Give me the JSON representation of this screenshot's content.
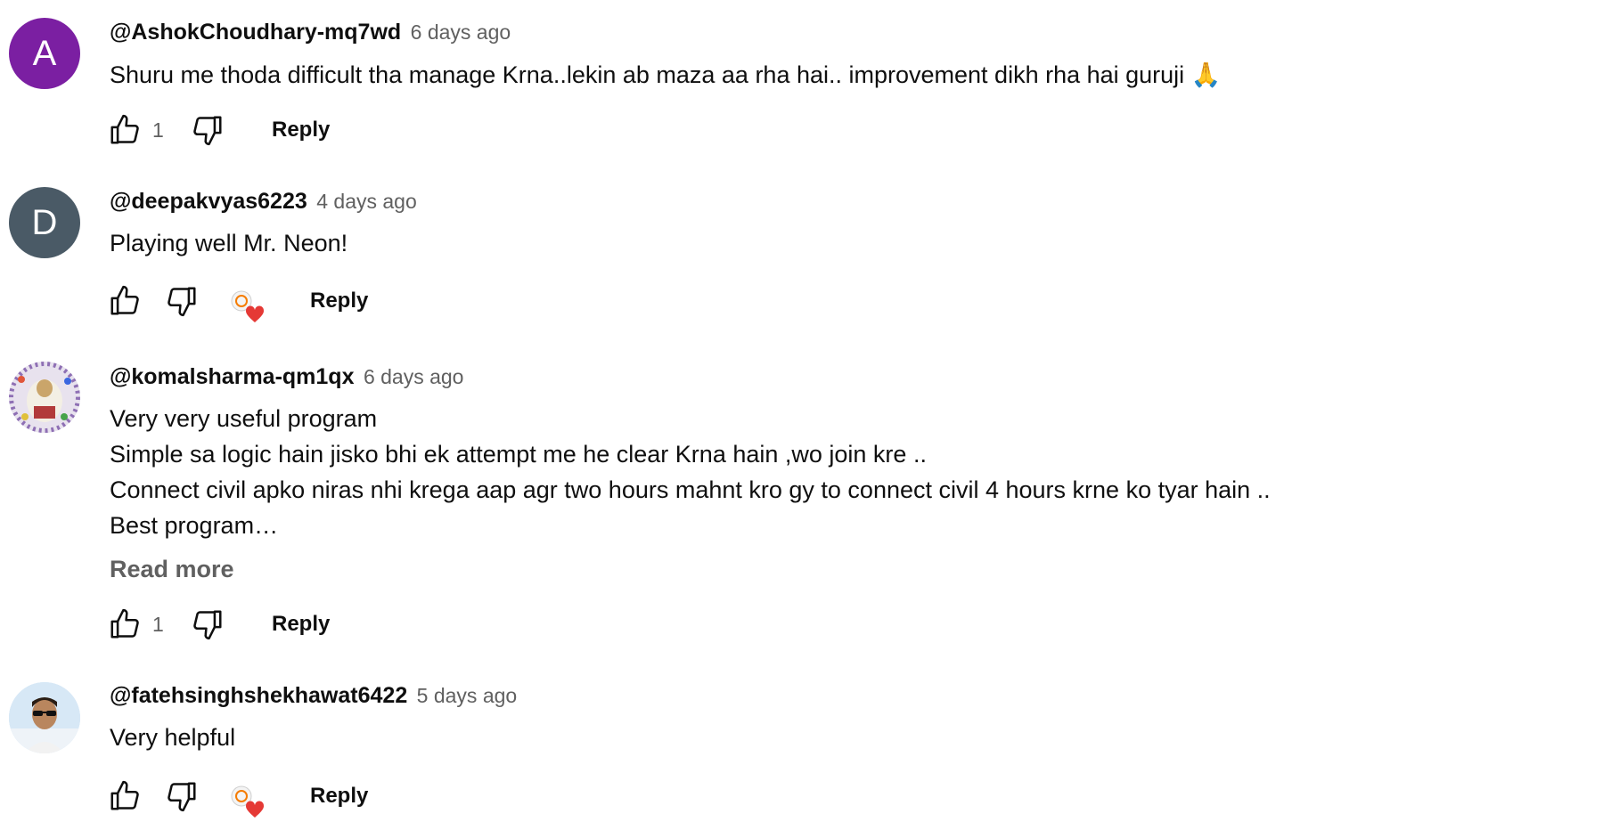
{
  "comments": [
    {
      "author": "@AshokChoudhary-mq7wd",
      "time": "6 days ago",
      "avatar_letter": "A",
      "avatar_color": "#7b1fa2",
      "lines": [
        "Shuru me thoda difficult tha manage Krna..lekin ab maza aa rha hai.. improvement dikh rha hai guruji 🙏"
      ],
      "likes": "1",
      "reply_label": "Reply"
    },
    {
      "author": "@deepakvyas6223",
      "time": "4 days ago",
      "avatar_letter": "D",
      "avatar_color": "#4a5a66",
      "lines": [
        "Playing well Mr. Neon!"
      ],
      "likes": "",
      "creator_heart": true,
      "reply_label": "Reply"
    },
    {
      "author": "@komalsharma-qm1qx",
      "time": "6 days ago",
      "avatar_letter": "",
      "lines": [
        "Very very useful program",
        "Simple sa logic hain jisko bhi ek attempt me he clear Krna hain ,wo join kre ..",
        "Connect civil apko niras nhi krega aap agr two hours mahnt kro gy to connect civil 4 hours krne ko tyar hain ..",
        "Best program…"
      ],
      "read_more": "Read more",
      "likes": "1",
      "reply_label": "Reply"
    },
    {
      "author": "@fatehsinghshekhawat6422",
      "time": "5 days ago",
      "avatar_letter": "",
      "lines": [
        "Very helpful"
      ],
      "likes": "",
      "creator_heart": true,
      "reply_label": "Reply"
    }
  ],
  "colors": {
    "heart": "#e53935",
    "secondary_text": "#606060"
  },
  "icons": [
    "like-icon",
    "dislike-icon",
    "creator-heart-icon"
  ]
}
